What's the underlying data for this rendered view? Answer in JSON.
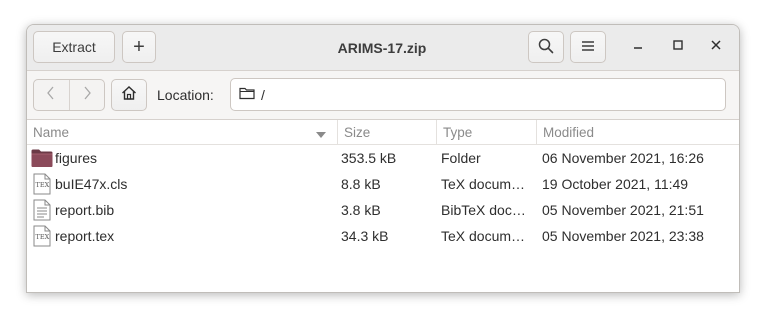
{
  "window": {
    "title": "ARIMS-17.zip"
  },
  "header": {
    "extract_label": "Extract",
    "add_label": "+"
  },
  "location": {
    "label": "Location:",
    "path": "/"
  },
  "columns": {
    "name": "Name",
    "size": "Size",
    "type": "Type",
    "modified": "Modified"
  },
  "files": [
    {
      "name": "figures",
      "size": "353.5 kB",
      "type": "Folder",
      "modified": "06 November 2021, 16:26",
      "icon": "folder-icon"
    },
    {
      "name": "buIE47x.cls",
      "size": "8.8 kB",
      "type": "TeX docum…",
      "modified": "19 October 2021, 11:49",
      "icon": "tex-file-icon"
    },
    {
      "name": "report.bib",
      "size": "3.8 kB",
      "type": "BibTeX doc…",
      "modified": "05 November 2021, 21:51",
      "icon": "text-file-icon"
    },
    {
      "name": "report.tex",
      "size": "34.3 kB",
      "type": "TeX docum…",
      "modified": "05 November 2021, 23:38",
      "icon": "tex-file-icon"
    }
  ]
}
